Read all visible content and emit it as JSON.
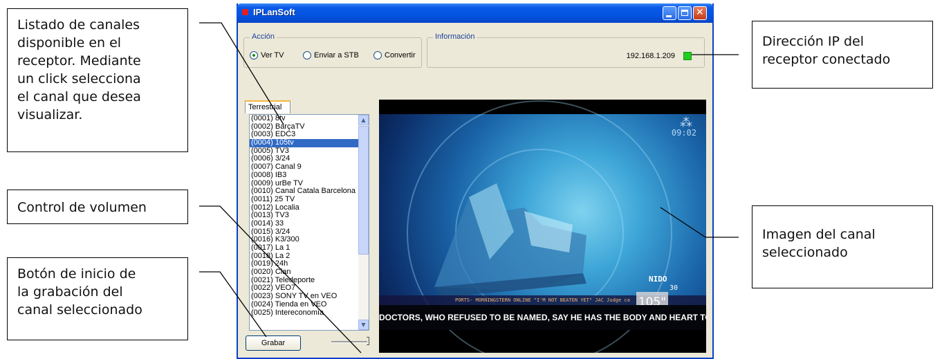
{
  "callouts": {
    "channel_list": "Listado de canales\ndisponible en el\nreceptor. Mediante\nun click selecciona\nel canal que desea\nvisualizar.",
    "volume": "Control de volumen",
    "record": "Botón de inicio de\nla grabación del\ncanal seleccionado",
    "ip": "Dirección IP del\nreceptor conectado",
    "image": "Imagen del canal\nseleccionado"
  },
  "window": {
    "title": "IPLanSoft"
  },
  "accion": {
    "label": "Acción",
    "options": [
      "Ver TV",
      "Enviar a STB",
      "Convertir"
    ],
    "selected_index": 0
  },
  "informacion": {
    "label": "Información",
    "ip": "192.168.1.209",
    "status_color": "#22cc22"
  },
  "tab": {
    "label": "Terrestrial"
  },
  "channels": [
    "(0001) 8tv",
    "(0002) BarçaTV",
    "(0003) EDC3",
    "(0004) 105tv",
    "(0005) TV3",
    "(0006) 3/24",
    "(0007) Canal 9",
    "(0008) IB3",
    "(0009) urBe TV",
    "(0010) Canal Catala Barcelona",
    "(0011) 25 TV",
    "(0012) Localia",
    "(0013) TV3",
    "(0014) 33",
    "(0015) 3/24",
    "(0016) K3/300",
    "(0017) La 1",
    "(0018) La 2",
    "(0019) 24h",
    "(0020) Clan",
    "(0021) Teledeporte",
    "(0022) VEO7",
    "(0023) SONY TV en VEO",
    "(0024) Tienda en VEO",
    "(0025) Intereconomía"
  ],
  "selected_channel_index": 3,
  "controls": {
    "record_label": "Grabar",
    "volume_level": 1.0
  },
  "video": {
    "time": "09:02",
    "osd_title": "NIDO",
    "osd_number": "30",
    "badge": "105\"",
    "ticker_top": "PORTS- MORNINGSTERN ONLINE \"I'M NOT BEATEN YET\" JAC  Judge ca",
    "ticker_bottom": "DOCTORS, WHO REFUSED TO BE NAMED, SAY HE HAS THE BODY AND HEART TO"
  }
}
